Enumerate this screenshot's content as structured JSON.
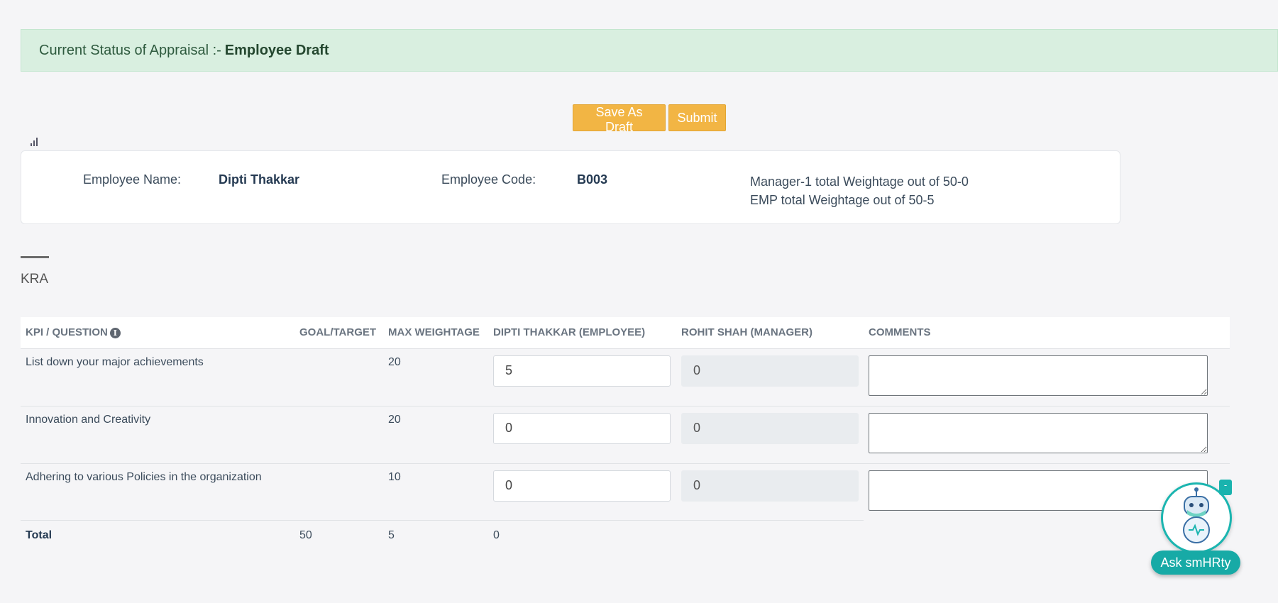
{
  "status": {
    "label": "Current Status of Appraisal :-",
    "value": "Employee Draft"
  },
  "actions": {
    "save_label": "Save As Draft",
    "submit_label": "Submit"
  },
  "employee": {
    "name_label": "Employee Name:",
    "name": "Dipti Thakkar",
    "code_label": "Employee Code:",
    "code": "B003",
    "manager_weightage": "Manager-1 total Weightage out of 50-0",
    "emp_weightage": "EMP total Weightage out of 50-5"
  },
  "kra": {
    "title": "KRA",
    "columns": {
      "kpi": "KPI / QUESTION",
      "goal": "GOAL/TARGET",
      "max": "MAX WEIGHTAGE",
      "employee": "DIPTI THAKKAR (EMPLOYEE)",
      "manager": "ROHIT SHAH (MANAGER)",
      "comments": "COMMENTS"
    },
    "rows": [
      {
        "question": "List down your major achievements",
        "goal": "",
        "max": "20",
        "employee": "5",
        "manager": "0",
        "comment": ""
      },
      {
        "question": "Innovation and Creativity",
        "goal": "",
        "max": "20",
        "employee": "0",
        "manager": "0",
        "comment": ""
      },
      {
        "question": "Adhering to various Policies in the organization",
        "goal": "",
        "max": "10",
        "employee": "0",
        "manager": "0",
        "comment": ""
      }
    ],
    "total": {
      "label": "Total",
      "goal": "50",
      "max": "5",
      "employee": "0"
    }
  },
  "chatbot": {
    "label": "Ask smHRty",
    "minimize": "-"
  }
}
